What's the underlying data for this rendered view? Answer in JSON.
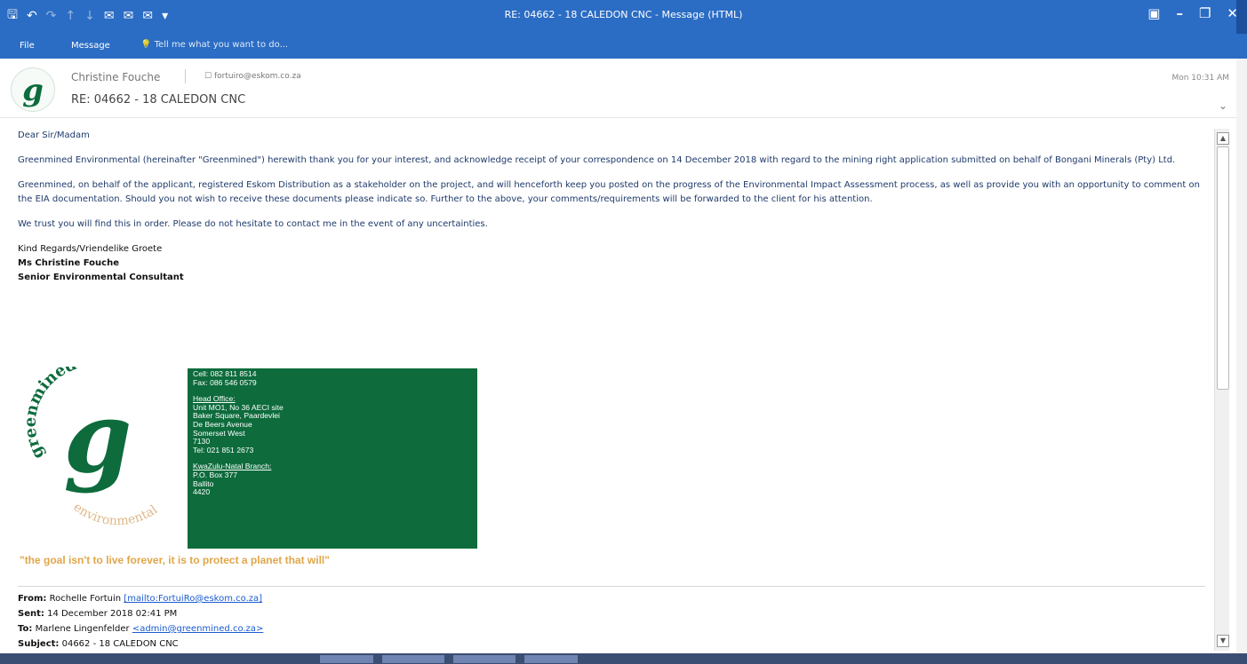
{
  "window": {
    "title": "RE: 04662 - 18  CALEDON CNC - Message (HTML)"
  },
  "ribbon": {
    "file_tab": "File",
    "message_tab": "Message",
    "tell_me": "Tell me what you want to do..."
  },
  "header": {
    "sender": "Christine Fouche",
    "recipient": "fortuiro@eskom.co.za",
    "subject": "RE: 04662 - 18  CALEDON CNC",
    "time": "Mon 10:31 AM"
  },
  "body": {
    "greeting": "Dear Sir/Madam",
    "p1": "Greenmined Environmental (hereinafter \"Greenmined\") herewith thank you for your interest, and acknowledge receipt of your correspondence on 14 December 2018 with regard to the mining right application submitted on behalf of Bongani Minerals (Pty) Ltd.",
    "p2": "Greenmined, on behalf of the applicant,  registered Eskom Distribution as a stakeholder on the project, and will henceforth keep you posted on the progress of the Environmental Impact Assessment process, as well as provide you with an opportunity to comment on the EIA documentation.  Should you not wish to receive these documents please indicate so.  Further to the above, your comments/requirements will be forwarded to the client for his attention.",
    "p3": "We trust you will find this in order.  Please do not hesitate to contact me in the event of any uncertainties.",
    "sig_regards": "Kind Regards/Vriendelike Groete",
    "sig_name": "Ms Christine Fouche",
    "sig_title": "Senior Environmental Consultant"
  },
  "signature_box": {
    "cell": "Cell: 082 811 8514",
    "fax": "Fax: 086 546 0579",
    "head_office_label": "Head Office:",
    "head_office_lines": [
      "Unit MO1, No 36 AECI site",
      "Baker Square, Paardevlei",
      "De Beers Avenue",
      "Somerset West",
      "7130",
      "Tel: 021 851 2673"
    ],
    "branch_label": "KwaZulu-Natal Branch:",
    "branch_lines": [
      "P.O. Box 377",
      "Ballito",
      "4420"
    ]
  },
  "logo": {
    "top_text": "greenmined",
    "letter": "g",
    "bottom_text": "environmental"
  },
  "motto": "\"the goal isn't to live forever, it is to protect a planet that will\"",
  "forward": {
    "from_label": "From:",
    "from_name": "Rochelle Fortuin",
    "from_link": "[mailto:FortuiRo@eskom.co.za]",
    "sent_label": "Sent:",
    "sent_value": "14 December 2018 02:41 PM",
    "to_label": "To:",
    "to_name": "Marlene Lingenfelder",
    "to_link": "<admin@greenmined.co.za>",
    "subject_label": "Subject:",
    "subject_value": "04662 - 18 CALEDON CNC"
  },
  "colors": {
    "titlebar": "#2b6cc4",
    "signature_bg": "#0d6b3c",
    "motto": "#e0a64a",
    "body_text": "#1f3a6b"
  }
}
